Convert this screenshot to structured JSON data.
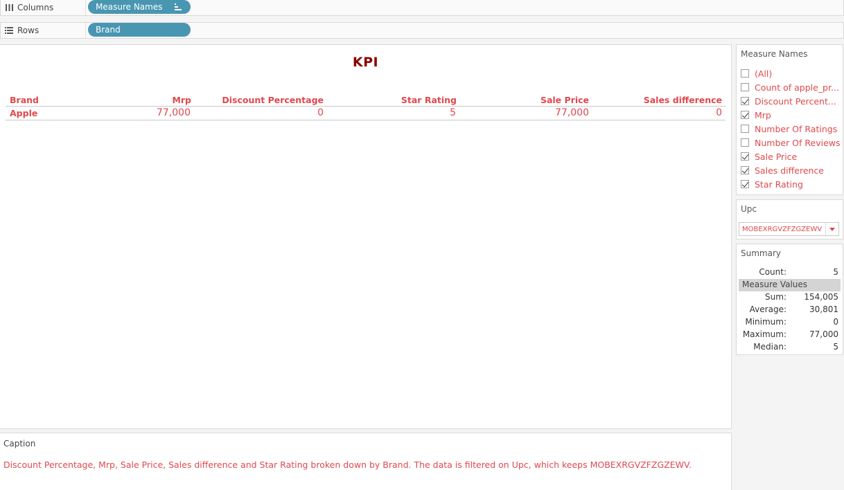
{
  "shelves": {
    "columns": {
      "label": "Columns",
      "pill": "Measure Names"
    },
    "rows": {
      "label": "Rows",
      "pill": "Brand"
    }
  },
  "view": {
    "title": "KPI",
    "headers": [
      "Brand",
      "Mrp",
      "Discount Percentage",
      "Star Rating",
      "Sale Price",
      "Sales difference"
    ],
    "row": [
      "Apple",
      "77,000",
      "0",
      "5",
      "77,000",
      "0"
    ]
  },
  "measure_names": {
    "title": "Measure Names",
    "items": [
      {
        "label": "(All)",
        "checked": false
      },
      {
        "label": "Count of apple_pr...",
        "checked": false
      },
      {
        "label": "Discount Percent...",
        "checked": true
      },
      {
        "label": "Mrp",
        "checked": true
      },
      {
        "label": "Number Of Ratings",
        "checked": false
      },
      {
        "label": "Number Of Reviews",
        "checked": false
      },
      {
        "label": "Sale Price",
        "checked": true
      },
      {
        "label": "Sales difference",
        "checked": true
      },
      {
        "label": "Star Rating",
        "checked": true
      }
    ]
  },
  "upc": {
    "title": "Upc",
    "value": "MOBEXRGVZFZGZEWV"
  },
  "summary": {
    "title": "Summary",
    "count_label": "Count:",
    "count_value": "5",
    "section": "Measure Values",
    "rows": [
      {
        "k": "Sum:",
        "v": "154,005"
      },
      {
        "k": "Average:",
        "v": "30,801"
      },
      {
        "k": "Minimum:",
        "v": "0"
      },
      {
        "k": "Maximum:",
        "v": "77,000"
      },
      {
        "k": "Median:",
        "v": "5"
      }
    ]
  },
  "caption": {
    "title": "Caption",
    "text": "Discount Percentage, Mrp, Sale Price, Sales difference and Star Rating broken down by Brand. The data is filtered on Upc, which keeps MOBEXRGVZFZGZEWV."
  },
  "colors": {
    "accent": "#e0484d",
    "title": "#8b0000",
    "pill": "#4996b2"
  }
}
